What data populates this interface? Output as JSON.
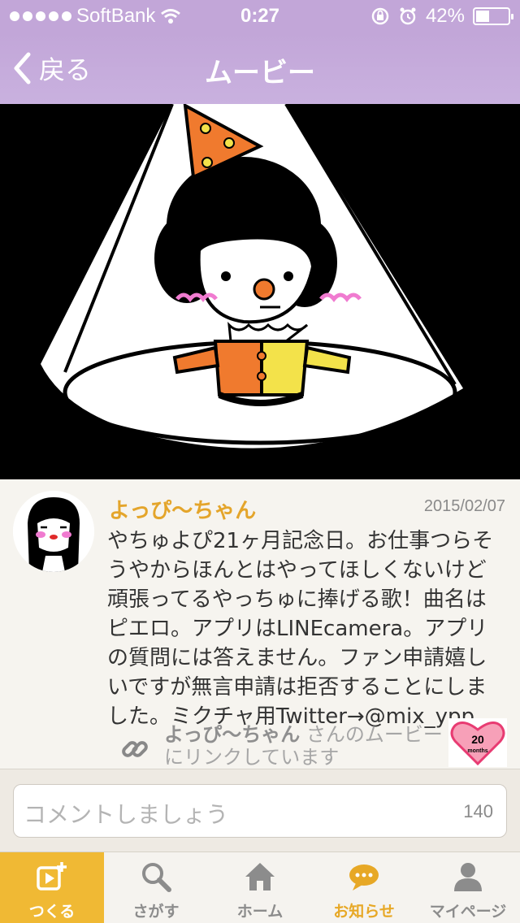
{
  "status_bar": {
    "carrier": "SoftBank",
    "time": "0:27",
    "battery": "42%",
    "battery_level": 0.42
  },
  "nav": {
    "back_label": "戻る",
    "title": "ムービー"
  },
  "post": {
    "author": "よっぴ〜ちゃん",
    "date": "2015/02/07",
    "body": "やちゅよぴ21ヶ月記念日。お仕事つらそうやからほんとはやってほしくないけど頑張ってるやっちゅに捧げる歌！曲名はピエロ。アプリはLINEcamera。アプリの質問には答えません。ファン申請嬉しいですが無言申請は拒否することにしました。ミクチャ用Twitter→@mix_ypp",
    "link_author": "よっぴ〜ちゃん",
    "link_text_suffix": " さんのムービーにリンクしています",
    "badge_number": "20",
    "badge_label": "months"
  },
  "comment": {
    "placeholder": "コメントしましょう",
    "count": "140"
  },
  "tabs": [
    {
      "label": "つくる",
      "icon": "create-movie-icon"
    },
    {
      "label": "さがす",
      "icon": "search-icon"
    },
    {
      "label": "ホーム",
      "icon": "home-icon"
    },
    {
      "label": "お知らせ",
      "icon": "notification-bubble-icon"
    },
    {
      "label": "マイページ",
      "icon": "user-icon"
    }
  ],
  "colors": {
    "nav_bg": "#c2a6d8",
    "accent": "#f0b934",
    "author": "#e4a52b"
  }
}
